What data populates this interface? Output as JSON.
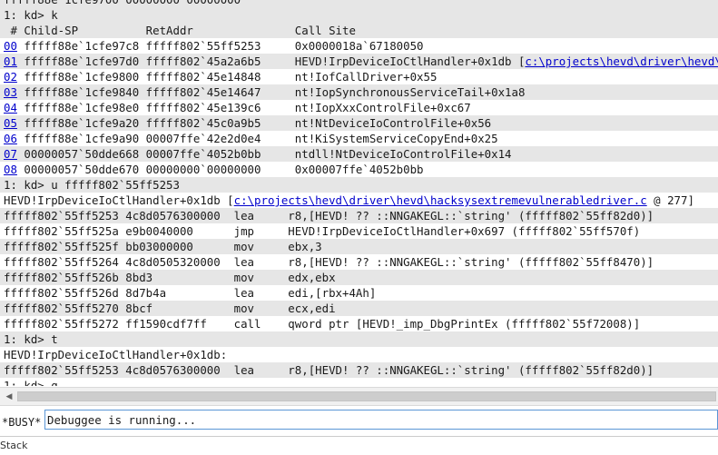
{
  "output_lines": [
    {
      "prompt": "",
      "text": "fffff88e`1cfe9700 00000000`00000000",
      "link": "",
      "tail": "",
      "highlight": true
    },
    {
      "prompt": "1: kd> ",
      "text": "k",
      "link": "",
      "tail": "",
      "highlight": true
    },
    {
      "prompt": "",
      "text": " # Child-SP          RetAddr               Call Site",
      "link": "",
      "tail": "",
      "highlight": true
    },
    {
      "prompt": "",
      "num": "00",
      "text": " fffff88e`1cfe97c8 fffff802`55ff5253     0x0000018a`67180050",
      "link": "",
      "tail": "",
      "highlight": false
    },
    {
      "prompt": "",
      "num": "01",
      "text": " fffff88e`1cfe97d0 fffff802`45a2a6b5     HEVD!IrpDeviceIoCtlHandler+0x1db [",
      "link": "c:\\projects\\hevd\\driver\\hevd\\hacksysextremevulnerabledriver.c",
      "tail": "",
      "highlight": true
    },
    {
      "prompt": "",
      "num": "02",
      "text": " fffff88e`1cfe9800 fffff802`45e14848     nt!IofCallDriver+0x55",
      "link": "",
      "tail": "",
      "highlight": false
    },
    {
      "prompt": "",
      "num": "03",
      "text": " fffff88e`1cfe9840 fffff802`45e14647     nt!IopSynchronousServiceTail+0x1a8",
      "link": "",
      "tail": "",
      "highlight": true
    },
    {
      "prompt": "",
      "num": "04",
      "text": " fffff88e`1cfe98e0 fffff802`45e139c6     nt!IopXxxControlFile+0xc67",
      "link": "",
      "tail": "",
      "highlight": false
    },
    {
      "prompt": "",
      "num": "05",
      "text": " fffff88e`1cfe9a20 fffff802`45c0a9b5     nt!NtDeviceIoControlFile+0x56",
      "link": "",
      "tail": "",
      "highlight": true
    },
    {
      "prompt": "",
      "num": "06",
      "text": " fffff88e`1cfe9a90 00007ffe`42e2d0e4     nt!KiSystemServiceCopyEnd+0x25",
      "link": "",
      "tail": "",
      "highlight": false
    },
    {
      "prompt": "",
      "num": "07",
      "text": " 00000057`50dde668 00007ffe`4052b0bb     ntdll!NtDeviceIoControlFile+0x14",
      "link": "",
      "tail": "",
      "highlight": true
    },
    {
      "prompt": "",
      "num": "08",
      "text": " 00000057`50dde670 00000000`00000000     0x00007ffe`4052b0bb",
      "link": "",
      "tail": "",
      "highlight": false
    },
    {
      "prompt": "1: kd> ",
      "text": "u fffff802`55ff5253",
      "link": "",
      "tail": "",
      "highlight": true
    },
    {
      "prompt": "",
      "text": "HEVD!IrpDeviceIoCtlHandler+0x1db [",
      "link": "c:\\projects\\hevd\\driver\\hevd\\hacksysextremevulnerabledriver.c",
      "tail": " @ 277]",
      "highlight": false
    },
    {
      "prompt": "",
      "text": "fffff802`55ff5253 4c8d0576300000  lea     r8,[HEVD! ?? ::NNGAKEGL::`string' (fffff802`55ff82d0)]",
      "link": "",
      "tail": "",
      "highlight": true
    },
    {
      "prompt": "",
      "text": "fffff802`55ff525a e9b0040000      jmp     HEVD!IrpDeviceIoCtlHandler+0x697 (fffff802`55ff570f)",
      "link": "",
      "tail": "",
      "highlight": false
    },
    {
      "prompt": "",
      "text": "fffff802`55ff525f bb03000000      mov     ebx,3",
      "link": "",
      "tail": "",
      "highlight": true
    },
    {
      "prompt": "",
      "text": "fffff802`55ff5264 4c8d0505320000  lea     r8,[HEVD! ?? ::NNGAKEGL::`string' (fffff802`55ff8470)]",
      "link": "",
      "tail": "",
      "highlight": false
    },
    {
      "prompt": "",
      "text": "fffff802`55ff526b 8bd3            mov     edx,ebx",
      "link": "",
      "tail": "",
      "highlight": true
    },
    {
      "prompt": "",
      "text": "fffff802`55ff526d 8d7b4a          lea     edi,[rbx+4Ah]",
      "link": "",
      "tail": "",
      "highlight": false
    },
    {
      "prompt": "",
      "text": "fffff802`55ff5270 8bcf            mov     ecx,edi",
      "link": "",
      "tail": "",
      "highlight": true
    },
    {
      "prompt": "",
      "text": "fffff802`55ff5272 ff1590cdf7ff    call    qword ptr [HEVD!_imp_DbgPrintEx (fffff802`55f72008)]",
      "link": "",
      "tail": "",
      "highlight": false
    },
    {
      "prompt": "1: kd> ",
      "text": "t",
      "link": "",
      "tail": "",
      "highlight": true
    },
    {
      "prompt": "",
      "text": "HEVD!IrpDeviceIoCtlHandler+0x1db:",
      "link": "",
      "tail": "",
      "highlight": false
    },
    {
      "prompt": "",
      "text": "fffff802`55ff5253 4c8d0576300000  lea     r8,[HEVD! ?? ::NNGAKEGL::`string' (fffff802`55ff82d0)]",
      "link": "",
      "tail": "",
      "highlight": true
    },
    {
      "prompt": "1: kd> ",
      "text": "g",
      "link": "",
      "tail": "",
      "highlight": false
    }
  ],
  "scrollbar": {
    "left_arrow": "◀"
  },
  "command": {
    "status": "*BUSY*",
    "value": "Debuggee is running..."
  },
  "bottom_tab": {
    "label": "Stack"
  },
  "colors": {
    "link": "#0000cc",
    "row_highlight": "#e6e6e6",
    "input_border": "#5a96d6"
  }
}
